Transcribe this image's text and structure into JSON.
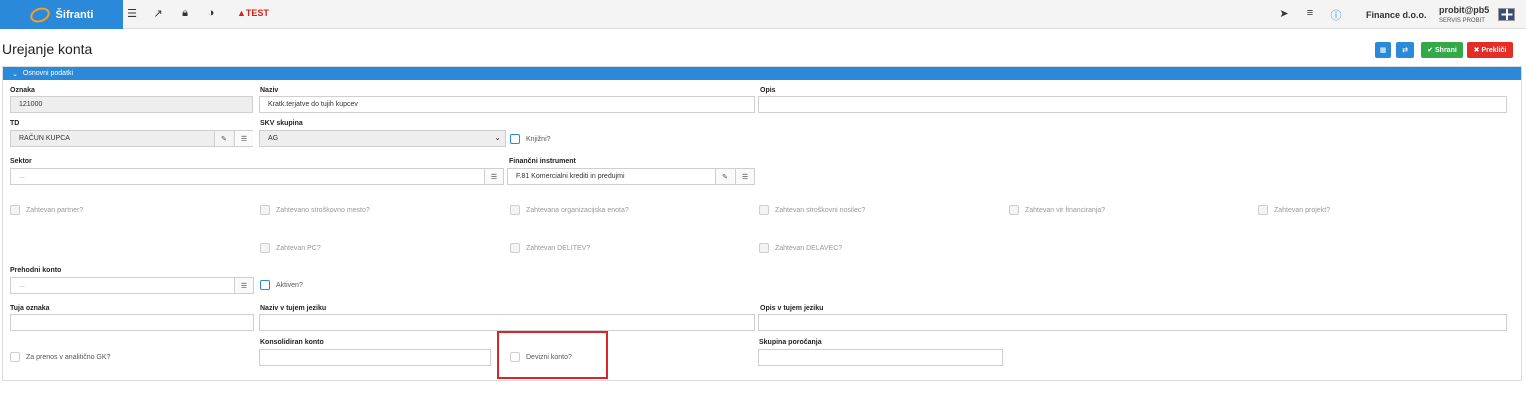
{
  "topbar": {
    "brand": "Šifranti",
    "test_label": "TEST",
    "company": "Finance d.o.o.",
    "user_name": "probit@pb5",
    "user_role": "SERVIS PROBIT",
    "icons": [
      "list-icon",
      "external-link-icon",
      "lock-icon",
      "contrast-icon",
      "warning-icon",
      "paper-plane-icon",
      "menu-icon",
      "info-icon",
      "flag-icon"
    ]
  },
  "page": {
    "title": "Urejanje konta",
    "save_label": "✔ Shrani",
    "cancel_label": "✖ Prekliči"
  },
  "section": {
    "title": "Osnovni podatki"
  },
  "form": {
    "oznaka": {
      "label": "Oznaka",
      "value": "121000"
    },
    "naziv": {
      "label": "Naziv",
      "value": "Kratk.terjatve do tujih kupcev"
    },
    "opis": {
      "label": "Opis",
      "value": ""
    },
    "td": {
      "label": "TD",
      "value": "RAČUN KUPCA"
    },
    "skv": {
      "label": "SKV skupina",
      "value": "AG"
    },
    "knjizni": {
      "label": "Knjižni?",
      "checked": true
    },
    "sektor": {
      "label": "Sektor",
      "placeholder": "..."
    },
    "fin_instr": {
      "label": "Finančni instrument",
      "value": "F.81 Komercialni krediti in predujmi"
    },
    "checkboxes_row1": [
      {
        "label": "Zahtevan partner?"
      },
      {
        "label": "Zahtevano stroškovno mesto?"
      },
      {
        "label": "Zahtevana organizacijska enota?"
      },
      {
        "label": "Zahtevan stroškovni nosilec?"
      },
      {
        "label": "Zahtevan vir financiranja?"
      },
      {
        "label": "Zahtevan projekt?"
      }
    ],
    "checkboxes_row2": [
      {
        "label": "Zahtevan PC?"
      },
      {
        "label": "Zahtevan DELITEV?"
      },
      {
        "label": "Zahtevan DELAVEC?"
      }
    ],
    "prehodni": {
      "label": "Prehodni konto",
      "placeholder": "..."
    },
    "aktiven": {
      "label": "Aktiven?",
      "checked": true
    },
    "tuja_oznaka": {
      "label": "Tuja oznaka",
      "value": ""
    },
    "naziv_tuj": {
      "label": "Naziv v tujem jeziku",
      "value": ""
    },
    "opis_tuj": {
      "label": "Opis v tujem jeziku",
      "value": ""
    },
    "za_prenos": {
      "label": "Za prenos v analitično GK?",
      "checked": false
    },
    "konsolidiran": {
      "label": "Konsolidiran konto",
      "value": ""
    },
    "devizni": {
      "label": "Devizni konto?",
      "checked": false
    },
    "skupina_por": {
      "label": "Skupina poročanja",
      "value": ""
    }
  },
  "colors": {
    "accent": "#2a8ad9",
    "save": "#35a84a",
    "cancel": "#e52d27",
    "highlight": "#d9252b"
  }
}
